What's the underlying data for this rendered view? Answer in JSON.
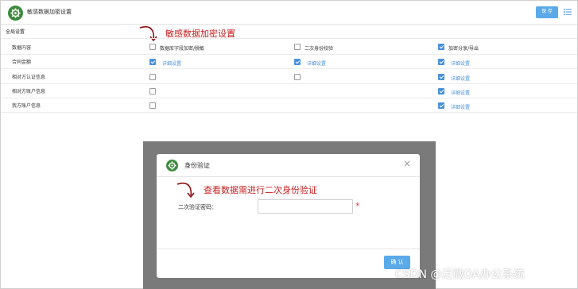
{
  "header": {
    "title": "敏感数据加密设置",
    "save_label": "保 存"
  },
  "section": {
    "title": "全局设置"
  },
  "annotations": {
    "main": "敏感数据加密设置",
    "dialog": "查看数据需进行二次身份验证"
  },
  "table": {
    "columns": [
      {
        "label": "数据内容"
      },
      {
        "label": "数据库字段加密/脱敏",
        "checked": false
      },
      {
        "label": "二次身份校验",
        "checked": false
      },
      {
        "label": "加密分享/导出",
        "checked": true
      }
    ],
    "rows": [
      {
        "name": "合同金额",
        "db": true,
        "db_link": "详细设置",
        "auth": true,
        "auth_link": "详细设置",
        "share": true,
        "share_link": "详细设置"
      },
      {
        "name": "相对方认证信息",
        "db": false,
        "db_link": "",
        "auth": false,
        "auth_link": "",
        "share": true,
        "share_link": "详细设置"
      },
      {
        "name": "相对方账户信息",
        "db": false,
        "db_link": "",
        "auth": null,
        "auth_link": "",
        "share": true,
        "share_link": "详细设置"
      },
      {
        "name": "我方账户信息",
        "db": false,
        "db_link": "",
        "auth": null,
        "auth_link": "",
        "share": true,
        "share_link": "详细设置"
      }
    ]
  },
  "dialog": {
    "title": "身份验证",
    "close_glyph": "×",
    "field_label": "二次验证密码：",
    "field_value": "",
    "required_mark": "*",
    "ok_label": "确 认"
  },
  "watermark": "CSDN @泛微OA办公系统",
  "colors": {
    "accent": "#5aa9e8",
    "checkbox": "#4a90d9",
    "annotation": "#c81e1e",
    "logo": "#3e8a3e",
    "overlay": "#7a7a7a"
  },
  "icons": {
    "logo": "gear-icon",
    "menu": "list-icon",
    "close": "close-icon",
    "arrow": "curved-arrow-icon"
  }
}
